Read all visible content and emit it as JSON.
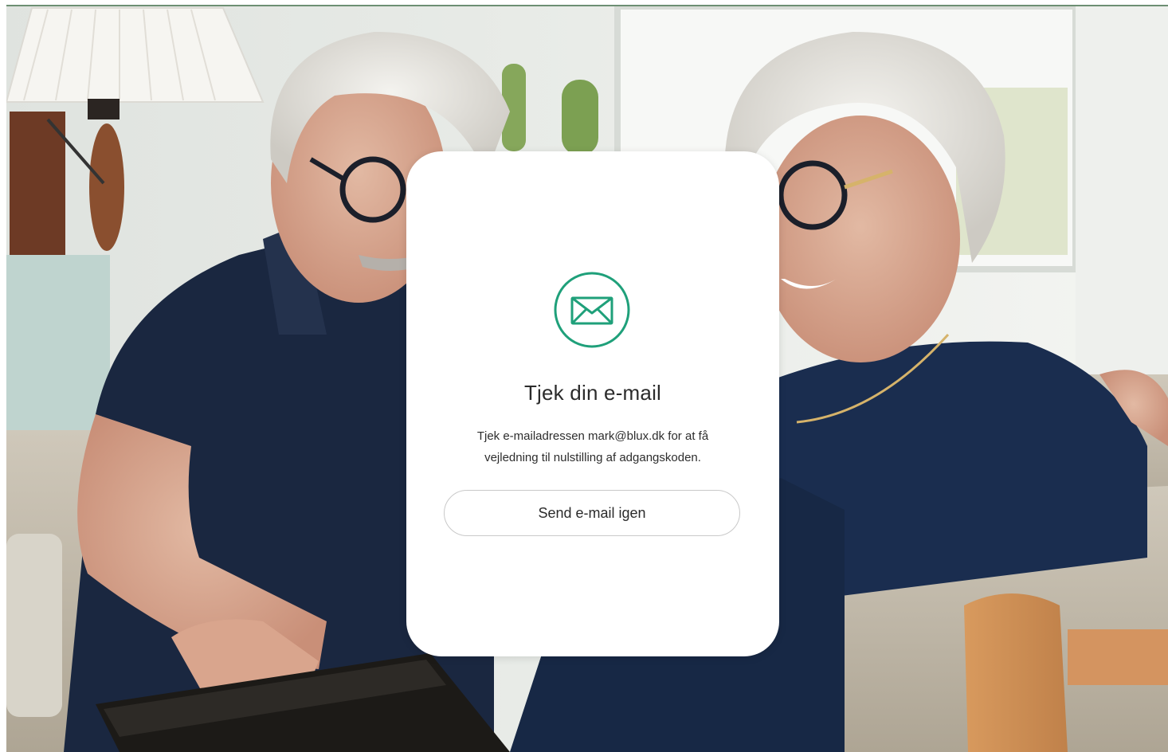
{
  "card": {
    "title": "Tjek din e-mail",
    "message": "Tjek e-mailadressen mark@blux.dk for at få vejledning til nulstilling af adgangskoden.",
    "resend_label": "Send e-mail igen",
    "icon": "envelope-icon"
  },
  "colors": {
    "accent": "#1fa07a",
    "card_background": "#ffffff",
    "text": "#2b2b2b"
  },
  "background": {
    "description_icon": "photo-couple-with-tablet"
  }
}
